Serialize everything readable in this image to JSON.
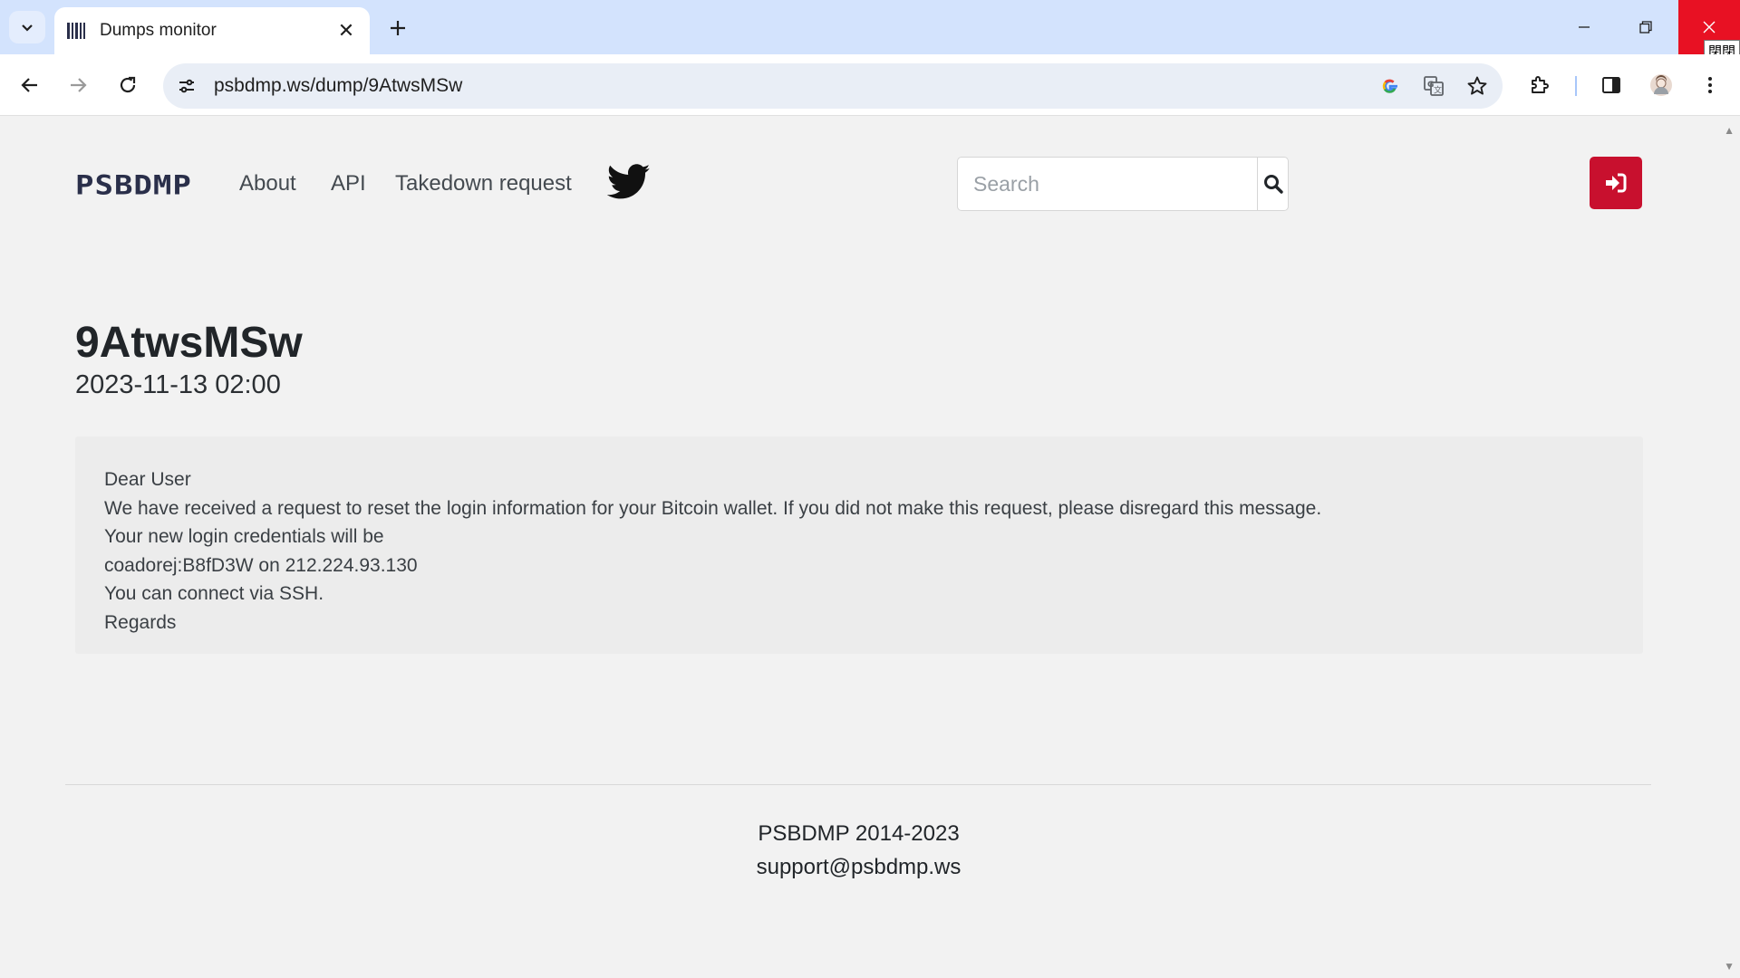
{
  "browser": {
    "tab_title": "Dumps monitor",
    "tab_close_glyph": "✕",
    "new_tab_glyph": "+",
    "url": "psbdmp.ws/dump/9AtwsMSw",
    "close_tooltip": "閉閉"
  },
  "site": {
    "brand": "PSBDMP",
    "nav": {
      "about": "About",
      "api": "API",
      "takedown": "Takedown request"
    },
    "search_placeholder": "Search",
    "accent_color": "#c8102e"
  },
  "dump": {
    "id": "9AtwsMSw",
    "date": "2023-11-13 02:00",
    "lines": [
      "Dear User",
      "We have received a request to reset the login information for your Bitcoin wallet. If you did not make this request, please disregard this message.",
      "Your new login credentials will be",
      "coadorej:B8fD3W on 212.224.93.130",
      "You can connect via SSH.",
      "Regards"
    ]
  },
  "footer": {
    "copyright": "PSBDMP 2014-2023",
    "email": "support@psbdmp.ws"
  }
}
